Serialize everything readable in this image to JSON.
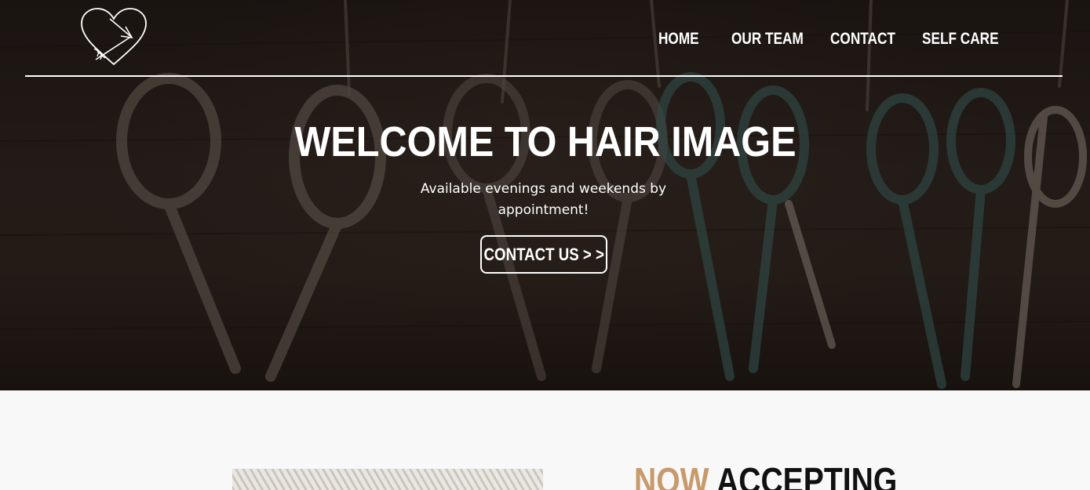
{
  "brand": {
    "logo_icon": "heart-arrow-icon"
  },
  "nav": {
    "items": [
      {
        "label": "HOME"
      },
      {
        "label": "OUR TEAM"
      },
      {
        "label": "CONTACT"
      },
      {
        "label": "SELF CARE"
      }
    ]
  },
  "hero": {
    "title": "WELCOME TO HAIR IMAGE",
    "subtitle": "Available evenings and weekends by appointment!",
    "cta_label": "CONTACT US  > >",
    "background_icon": "hanging-scissors-photo"
  },
  "section": {
    "heading_accent": "NOW",
    "heading_rest": "ACCEPTING",
    "image_icon": "macrame-photo"
  },
  "colors": {
    "accent": "#c79a6b",
    "hero_dark": "#2a221e",
    "page_bg": "#f8f8f8"
  }
}
